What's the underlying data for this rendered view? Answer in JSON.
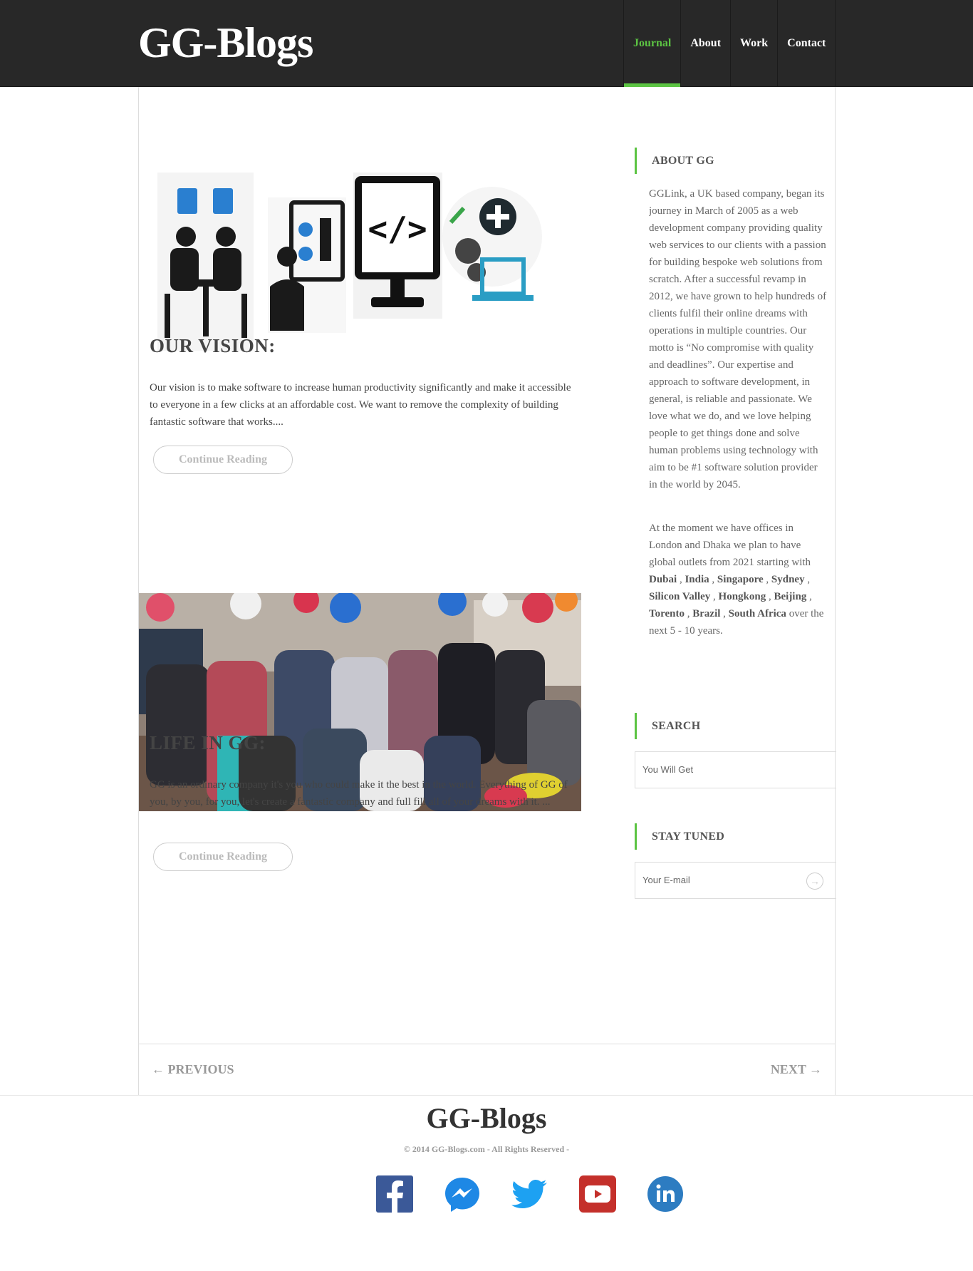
{
  "header": {
    "logo": "GG-Blogs",
    "nav": [
      "Journal",
      "About",
      "Work",
      "Contact"
    ]
  },
  "posts": [
    {
      "title": "OUR VISION:",
      "text": "Our vision is to make software to increase human productivity significantly and make it accessible to everyone in a few clicks at an affordable cost. We want to remove the complexity of building fantastic software that works....",
      "button": "Continue Reading"
    },
    {
      "title": "LIFE IN GG:",
      "text": "GG is an ordinary company it's you who could make it the best in the world. Everything of GG of you, by you, for you, let's create a fantastic company and full fill all of your dreams with it. ...",
      "button": "Continue Reading"
    }
  ],
  "sidebar": {
    "about_heading": "ABOUT GG",
    "about_lines": [
      "GGLink, a UK based company, began its",
      "journey in March of 2005 as a web",
      "development company providing quality",
      "web services to our clients with a passion",
      "for building bespoke web solutions from",
      "scratch. After a successful revamp in",
      "2012, we have grown to help hundreds of",
      "clients fulfil their online dreams with",
      "operations in multiple countries. Our",
      "motto is “No compromise with quality",
      "and deadlines”. Our expertise and",
      "approach to software development, in",
      "general, is reliable and passionate. We",
      "love what we do, and we love helping",
      "people to get things done and solve",
      "human problems using technology with",
      "aim to be #1 software solution provider",
      "in the world by 2045."
    ],
    "offices_intro_1": "At the moment we have offices in",
    "offices_intro_2": "London and Dhaka we plan to have",
    "offices_intro_3": "global outlets from 2021 starting with",
    "cities": [
      "Dubai",
      "India",
      "Singapore",
      "Sydney",
      "Silicon Valley",
      "Hongkong",
      "Beijing",
      "Torento",
      "Brazil",
      "South Africa"
    ],
    "offices_outro_1": "over the",
    "offices_outro_2": "next 5 - 10 years.",
    "search_heading": "SEARCH",
    "search_placeholder": "You Will Get",
    "newsletter_heading": "STAY TUNED",
    "email_placeholder": "Your E-mail"
  },
  "pager": {
    "prev": "← PREVIOUS",
    "next": "NEXT →"
  },
  "footer": {
    "logo": "GG-Blogs",
    "copyright": "© 2014 GG-Blogs.com - All Rights Reserved -",
    "socials": [
      "facebook-icon",
      "messenger-icon",
      "twitter-icon",
      "youtube-icon",
      "linkedin-icon"
    ]
  },
  "colors": {
    "accent": "#5cc443",
    "header_bg": "#282828"
  }
}
